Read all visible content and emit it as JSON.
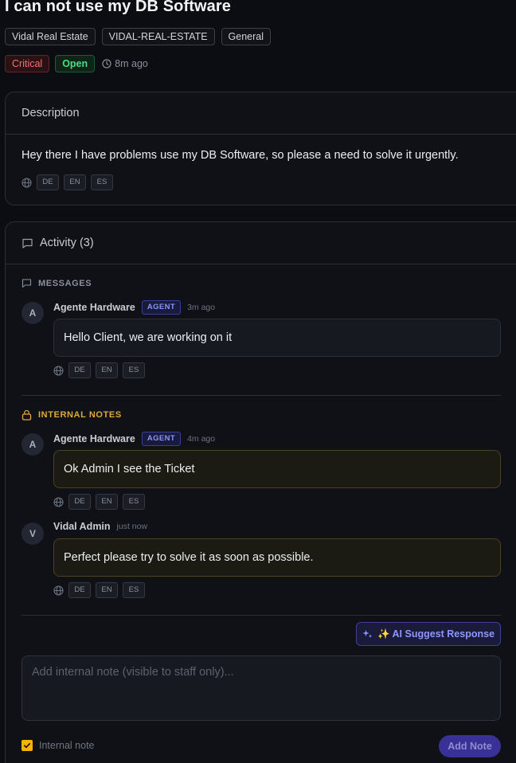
{
  "ticket": {
    "title": "I can not use my DB Software",
    "tags": [
      "Vidal Real Estate",
      "VIDAL-REAL-ESTATE",
      "General"
    ],
    "priority": "Critical",
    "status": "Open",
    "created_ago": "8m ago"
  },
  "description": {
    "heading": "Description",
    "text": "Hey there I have problems use my DB Software, so please a need to solve it urgently.",
    "languages": [
      "DE",
      "EN",
      "ES"
    ]
  },
  "activity": {
    "heading": "Activity (3)",
    "messages_label": "MESSAGES",
    "internal_notes_label": "INTERNAL NOTES",
    "messages": [
      {
        "initial": "A",
        "author": "Agente Hardware",
        "role": "AGENT",
        "ago": "3m ago",
        "text": "Hello Client, we are working on it",
        "languages": [
          "DE",
          "EN",
          "ES"
        ]
      }
    ],
    "notes": [
      {
        "initial": "A",
        "author": "Agente Hardware",
        "role": "AGENT",
        "ago": "4m ago",
        "text": "Ok Admin I see the Ticket",
        "languages": [
          "DE",
          "EN",
          "ES"
        ]
      },
      {
        "initial": "V",
        "author": "Vidal Admin",
        "role": "",
        "ago": "just now",
        "text": "Perfect please try to solve it as soon as possible.",
        "languages": [
          "DE",
          "EN",
          "ES"
        ]
      }
    ]
  },
  "composer": {
    "ai_suggest_label": "✨ AI Suggest Response",
    "placeholder": "Add internal note (visible to staff only)...",
    "internal_note_label": "Internal note",
    "internal_note_checked": true,
    "add_note_label": "Add Note"
  },
  "colors": {
    "accent": "#8e96ff",
    "critical": "#f87171",
    "open": "#4ade80",
    "internal": "#e0a93a"
  }
}
